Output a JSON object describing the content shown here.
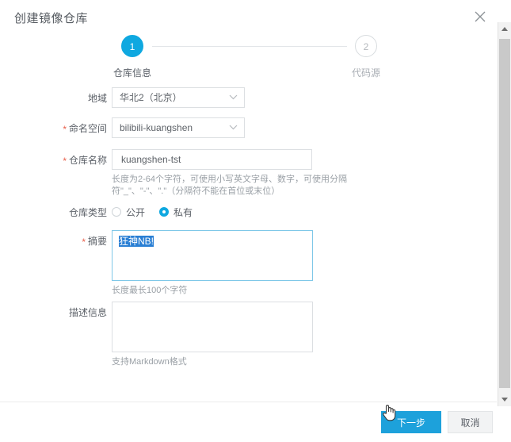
{
  "dialog": {
    "title": "创建镜像仓库",
    "close_icon": "close-icon"
  },
  "steps": [
    {
      "num": "1",
      "label": "仓库信息",
      "state": "active"
    },
    {
      "num": "2",
      "label": "代码源",
      "state": "inactive"
    }
  ],
  "form": {
    "region": {
      "label": "地域",
      "required": false,
      "value": "华北2（北京）",
      "icon": "chevron-down-icon"
    },
    "namespace": {
      "label": "命名空间",
      "required": true,
      "required_mark": "*",
      "value": "bilibili-kuangshen",
      "icon": "chevron-down-icon"
    },
    "repo_name": {
      "label": "仓库名称",
      "required": true,
      "required_mark": "*",
      "value": "kuangshen-tst",
      "placeholder": "",
      "helper": "长度为2-64个字符，可使用小写英文字母、数字，可使用分隔符\"_\"、\"-\"、\".\"（分隔符不能在首位或末位）"
    },
    "repo_type": {
      "label": "仓库类型",
      "required": false,
      "options": [
        {
          "label": "公开",
          "checked": false
        },
        {
          "label": "私有",
          "checked": true
        }
      ]
    },
    "summary": {
      "label": "摘要",
      "required": true,
      "required_mark": "*",
      "value": "狂神NB!",
      "selected": true,
      "helper": "长度最长100个字符"
    },
    "description": {
      "label": "描述信息",
      "required": false,
      "value": "",
      "helper": "支持Markdown格式"
    }
  },
  "footer": {
    "primary_label": "下一步",
    "cancel_label": "取消"
  },
  "colors": {
    "accent": "#0fa8e0",
    "primary_button": "#1da1db",
    "required_star": "#e8604c",
    "selection": "#2a7fd4"
  }
}
